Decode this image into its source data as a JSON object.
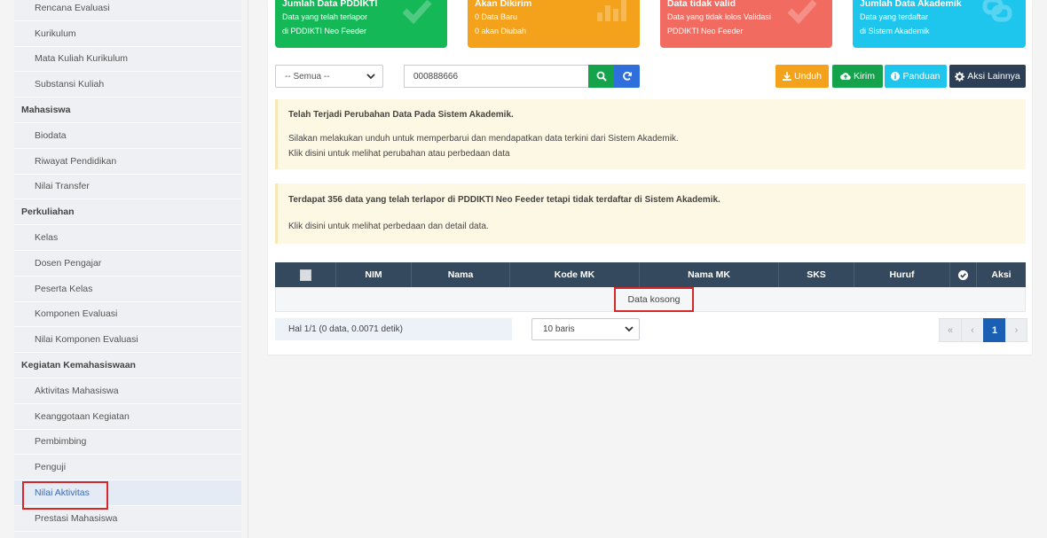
{
  "sidebar": {
    "items": [
      {
        "label": "Rencana Evaluasi",
        "type": "item"
      },
      {
        "label": "Kurikulum",
        "type": "item"
      },
      {
        "label": "Mata Kuliah Kurikulum",
        "type": "item"
      },
      {
        "label": "Substansi Kuliah",
        "type": "item"
      },
      {
        "label": "Mahasiswa",
        "type": "head"
      },
      {
        "label": "Biodata",
        "type": "item"
      },
      {
        "label": "Riwayat Pendidikan",
        "type": "item"
      },
      {
        "label": "Nilai Transfer",
        "type": "item"
      },
      {
        "label": "Perkuliahan",
        "type": "head"
      },
      {
        "label": "Kelas",
        "type": "item"
      },
      {
        "label": "Dosen Pengajar",
        "type": "item"
      },
      {
        "label": "Peserta Kelas",
        "type": "item"
      },
      {
        "label": "Komponen Evaluasi",
        "type": "item"
      },
      {
        "label": "Nilai Komponen Evaluasi",
        "type": "item"
      },
      {
        "label": "Kegiatan Kemahasiswaan",
        "type": "head"
      },
      {
        "label": "Aktivitas Mahasiswa",
        "type": "item"
      },
      {
        "label": "Keanggotaan Kegiatan",
        "type": "item"
      },
      {
        "label": "Pembimbing",
        "type": "item"
      },
      {
        "label": "Penguji",
        "type": "item"
      },
      {
        "label": "Nilai Aktivitas",
        "type": "item",
        "active": true
      },
      {
        "label": "Prestasi Mahasiswa",
        "type": "item"
      }
    ]
  },
  "cards": [
    {
      "title": "Jumlah Data PDDIKTI",
      "line1": "Data yang telah terlapor",
      "line2": "di PDDIKTI Neo Feeder",
      "color": "#14b856",
      "icon": "check-icon"
    },
    {
      "title": "Akan Dikirim",
      "line1": "0 Data Baru",
      "line2": "0 akan Diubah",
      "color": "#f4a21b",
      "icon": "bar-chart-icon"
    },
    {
      "title": "Data tidak valid",
      "line1": "Data yang tidak lolos Validasi",
      "line2": "PDDIKTI Neo Feeder",
      "color": "#f26b61",
      "icon": "check-icon"
    },
    {
      "title": "Jumlah Data Akademik",
      "line1": "Data yang terdaftar",
      "line2": "di Sistem Akademik",
      "color": "#1ec6ee",
      "icon": "link-icon"
    }
  ],
  "toolbar": {
    "filter_value": "-- Semua --",
    "search_value": "000888666",
    "buttons": {
      "unduh": "Unduh",
      "kirim": "Kirim",
      "panduan": "Panduan",
      "aksi": "Aksi Lainnya"
    }
  },
  "alerts": [
    {
      "title": "Telah Terjadi Perubahan Data Pada Sistem Akademik.",
      "line1": "Silakan melakukan unduh untuk memperbarui dan mendapatkan data terkini dari Sistem Akademik.",
      "line2": "Klik disini untuk melihat perubahan atau perbedaan data"
    },
    {
      "title": "Terdapat 356 data yang telah terlapor di PDDIKTI Neo Feeder tetapi tidak terdaftar di Sistem Akademik.",
      "line1": "Klik disini untuk melihat perbedaan dan detail data."
    }
  ],
  "table": {
    "columns": [
      "NIM",
      "Nama",
      "Kode MK",
      "Nama MK",
      "SKS",
      "Huruf",
      "Aksi"
    ],
    "empty_text": "Data kosong"
  },
  "footer": {
    "info": "Hal 1/1 (0 data, 0.0071 detik)",
    "rows_value": "10 baris",
    "pager": {
      "first": "«",
      "prev": "‹",
      "current": "1",
      "next": "›"
    }
  }
}
